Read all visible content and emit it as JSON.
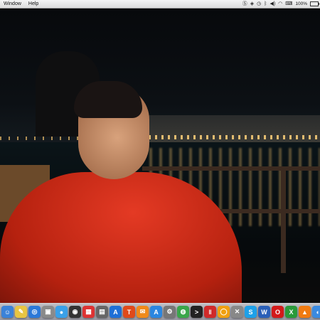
{
  "menubar": {
    "items": [
      "Window",
      "Help"
    ],
    "battery_text": "100%"
  },
  "dock": {
    "icons": [
      {
        "name": "finder-icon",
        "glyph": "☺",
        "color": "#3b82d8"
      },
      {
        "name": "notes-icon",
        "glyph": "✎",
        "color": "#e8c542"
      },
      {
        "name": "safari-icon",
        "glyph": "◎",
        "color": "#2b78d8"
      },
      {
        "name": "preview-icon",
        "glyph": "▣",
        "color": "#8a8a8a"
      },
      {
        "name": "messages-icon",
        "glyph": "●",
        "color": "#3aa0e8"
      },
      {
        "name": "camera-icon",
        "glyph": "◉",
        "color": "#333333"
      },
      {
        "name": "calendar-icon",
        "glyph": "▦",
        "color": "#d33"
      },
      {
        "name": "photos-icon",
        "glyph": "▤",
        "color": "#666666"
      },
      {
        "name": "appstore-icon",
        "glyph": "A",
        "color": "#1e6fd6"
      },
      {
        "name": "hammer-icon",
        "glyph": "T",
        "color": "#e04a1a"
      },
      {
        "name": "ibooks-icon",
        "glyph": "✉",
        "color": "#f08a1a"
      },
      {
        "name": "appstore2-icon",
        "glyph": "A",
        "color": "#2a86e0"
      },
      {
        "name": "utility-icon",
        "glyph": "⚙",
        "color": "#777777"
      },
      {
        "name": "chrome-icon",
        "glyph": "◍",
        "color": "#3aa64a"
      },
      {
        "name": "terminal-icon",
        "glyph": ">",
        "color": "#222222"
      },
      {
        "name": "parallels-icon",
        "glyph": "‖",
        "color": "#d02a2a"
      },
      {
        "name": "vlc-icon",
        "glyph": "◯",
        "color": "#f0a010"
      },
      {
        "name": "tools-icon",
        "glyph": "✕",
        "color": "#888888"
      },
      {
        "name": "skype-icon",
        "glyph": "S",
        "color": "#1ea0e8"
      },
      {
        "name": "word-icon",
        "glyph": "W",
        "color": "#2a5fb8"
      },
      {
        "name": "opera-icon",
        "glyph": "O",
        "color": "#d21a1a"
      },
      {
        "name": "excel-icon",
        "glyph": "X",
        "color": "#2a9a3a"
      },
      {
        "name": "cone-icon",
        "glyph": "▲",
        "color": "#f07a10"
      },
      {
        "name": "globe-icon",
        "glyph": "◐",
        "color": "#3a8ae0"
      }
    ]
  }
}
